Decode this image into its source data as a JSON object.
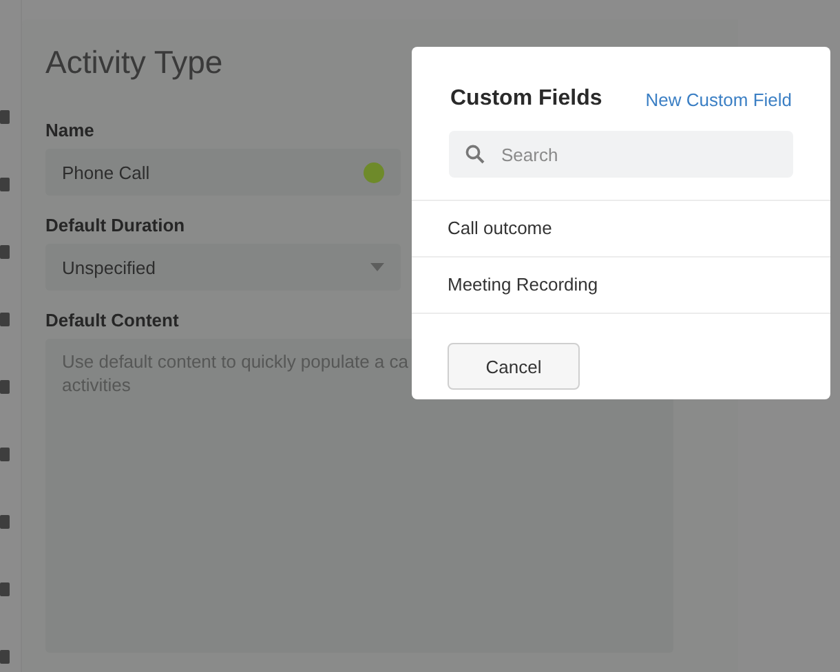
{
  "page": {
    "title": "Activity Type",
    "fields": [
      {
        "kind": "text",
        "label": "Name",
        "value": "Phone Call",
        "color": "#6e8a2a"
      },
      {
        "kind": "select",
        "label": "Default Duration",
        "value": "Unspecified"
      },
      {
        "kind": "textarea",
        "label": "Default Content",
        "placeholder_lines": [
          "Use default content to quickly populate a ca",
          "activities"
        ]
      }
    ]
  },
  "dialog": {
    "title": "Custom Fields",
    "link": "New Custom Field",
    "search": {
      "placeholder": "Search"
    },
    "items": [
      "Call outcome",
      "Meeting Recording"
    ],
    "buttons": [
      "Cancel"
    ]
  }
}
